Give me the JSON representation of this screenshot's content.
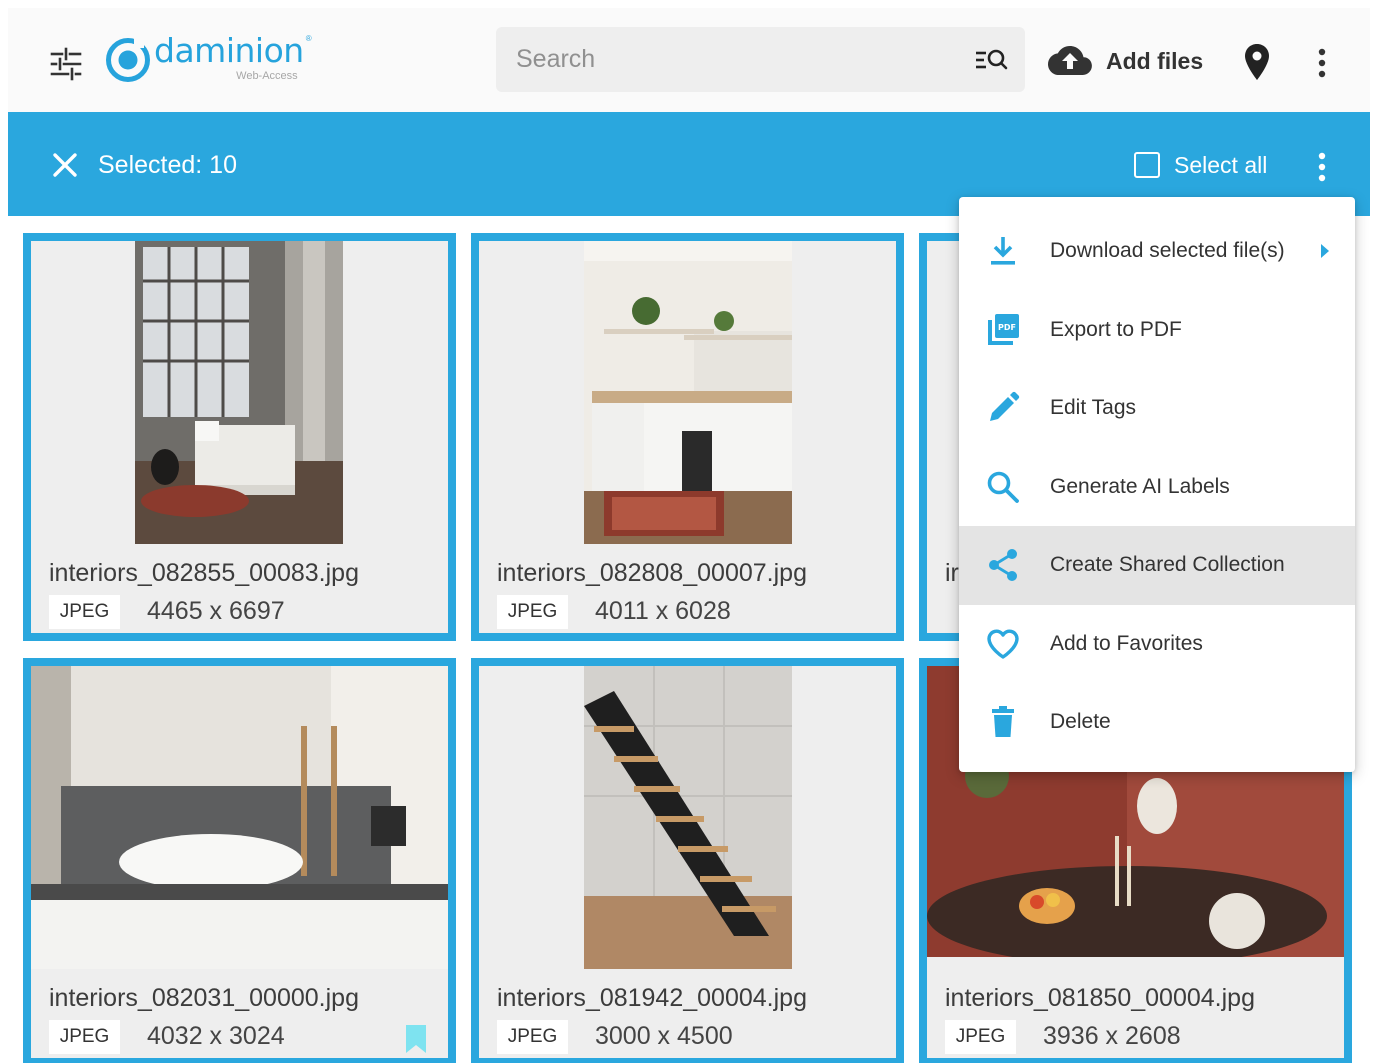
{
  "colors": {
    "accent": "#2aa7de",
    "logo": "#26a3dc",
    "card_bg": "#eeeeee",
    "bookmark": "#7ee3f0"
  },
  "header": {
    "logo_text": "daminion",
    "logo_reg": "®",
    "logo_sub": "Web-Access",
    "search_placeholder": "Search",
    "add_files_label": "Add files",
    "icons": [
      "filter-sliders-icon",
      "search-filter-icon",
      "cloud-upload-icon",
      "map-pin-icon",
      "more-vert-icon"
    ]
  },
  "selection_bar": {
    "selected_label": "Selected: 10",
    "select_all_label": "Select all"
  },
  "menu": {
    "items": [
      {
        "label": "Download selected file(s)",
        "icon": "download-icon",
        "has_submenu": true
      },
      {
        "label": "Export to PDF",
        "icon": "pdf-icon"
      },
      {
        "label": "Edit Tags",
        "icon": "pencil-icon"
      },
      {
        "label": "Generate AI Labels",
        "icon": "search-icon"
      },
      {
        "label": "Create Shared Collection",
        "icon": "share-icon",
        "highlighted": true
      },
      {
        "label": "Add to Favorites",
        "icon": "heart-icon"
      },
      {
        "label": "Delete",
        "icon": "trash-icon"
      }
    ]
  },
  "files": [
    {
      "name": "interiors_082855_00083.jpg",
      "type": "JPEG",
      "dims": "4465 x 6697"
    },
    {
      "name": "interiors_082808_00007.jpg",
      "type": "JPEG",
      "dims": "4011 x 6028"
    },
    {
      "name": "interiors_082031_00000.jpg",
      "type": "JPEG",
      "dims": "4032 x 3024",
      "bookmarked": true
    },
    {
      "name": "interiors_081942_00004.jpg",
      "type": "JPEG",
      "dims": "3000 x 4500"
    },
    {
      "name": "interiors_081850_00004.jpg",
      "type": "JPEG",
      "dims": "3936 x 2608"
    }
  ],
  "partial_card_name_fragment": "ir"
}
